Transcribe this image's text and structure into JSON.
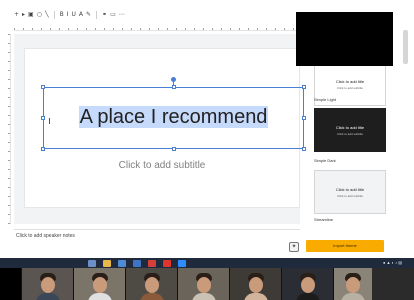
{
  "toolbar": {
    "icons": [
      "add-icon",
      "select-icon",
      "image-icon",
      "shape-icon",
      "line-icon",
      "bold-icon",
      "italic-icon",
      "underline-icon",
      "text-color-icon",
      "highlight-icon",
      "link-icon",
      "comment-icon",
      "more-icon"
    ]
  },
  "slide": {
    "title": "A place I recommend",
    "subtitle": "Click to add subtitle"
  },
  "notes": {
    "placeholder": "Click to add speaker notes"
  },
  "themes": {
    "cards": [
      {
        "title": "Click to add title",
        "sub": "Click to add subtitle",
        "name": "Simple Light",
        "bg": "#ffffff",
        "fg": "#222222"
      },
      {
        "title": "Click to add title",
        "sub": "Click to add subtitle",
        "name": "Simple Dark",
        "bg": "#1e1e1e",
        "fg": "#ffffff"
      },
      {
        "title": "Click to add title",
        "sub": "Click to add subtitle",
        "name": "Streamline",
        "bg": "#f1f3f4",
        "fg": "#222222"
      }
    ],
    "import_button": "Import theme"
  },
  "taskbar": {
    "apps": [
      {
        "icon": "search-icon",
        "color": "#6b8fc7"
      },
      {
        "icon": "file-explorer-icon",
        "color": "#e8b84a"
      },
      {
        "icon": "store-icon",
        "color": "#4d8bd6"
      },
      {
        "icon": "mail-icon",
        "color": "#3f73c6"
      },
      {
        "icon": "chrome-icon",
        "color": "#d6403a"
      },
      {
        "icon": "youtube-icon",
        "color": "#e0352c"
      },
      {
        "icon": "zoom-icon",
        "color": "#2d8cff"
      }
    ]
  },
  "colors": {
    "selection": "#4a7fd4",
    "accent": "#f9ab00"
  }
}
